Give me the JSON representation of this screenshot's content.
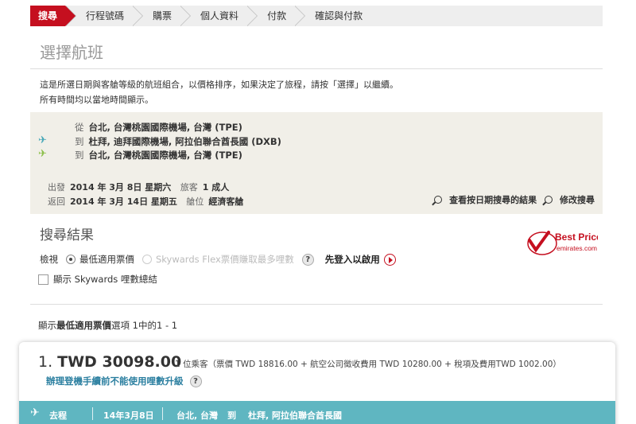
{
  "steps": [
    "搜尋",
    "行程號碼",
    "購票",
    "個人資料",
    "付款",
    "確認與付款"
  ],
  "page_title": "選擇航班",
  "intro": {
    "line1": "這是所選日期與客艙等級的航班組合，以價格排序，如果決定了旅程，請按「選擇」以繼續。",
    "line2": "所有時間均以當地時間顯示。"
  },
  "route": {
    "from_label": "從",
    "from": "台北, 台灣桃園國際機場, 台灣 (TPE)",
    "to_label": "到",
    "to1": "杜拜, 迪拜國際機場, 阿拉伯聯合酋長國 (DXB)",
    "to2": "台北, 台灣桃園國際機場, 台灣 (TPE)"
  },
  "meta": {
    "depart_label": "出發",
    "depart": "2014 年 3月 8日 星期六",
    "pax_label": "旅客",
    "pax": "1 成人",
    "return_label": "返回",
    "return": "2014 年 3月 14日 星期五",
    "cabin_label": "艙位",
    "cabin": "經濟客艙"
  },
  "links": {
    "view_by_date": "查看按日期搜尋的結果",
    "modify": "修改搜尋"
  },
  "results": {
    "title": "搜尋結果",
    "view_label": "檢視",
    "option_lowest": "最低適用票價",
    "option_skywards": "Skywards Flex票價賺取最多哩數",
    "login": "先登入以啟用",
    "show_miles": "顯示 Skywards 哩數總結",
    "count_prefix": "顯示",
    "count_bold": "最低適用票價",
    "count_suffix": "選項 1中的1 - 1"
  },
  "bestprice": {
    "line1": "Best Price",
    "line2": "emirates.com"
  },
  "card": {
    "index": "1.",
    "price": "TWD 30098.00",
    "breakdown": "1 位乘客（票價 TWD 18816.00 + 航空公司徵收費用 TWD 10280.00 + 稅項及費用TWD 1002.00）",
    "warning": "辦理登機手續前不能使用哩數升級",
    "leg_label": "去程",
    "leg_date": "14年3月8日",
    "leg_from": "台北, 台灣",
    "leg_to_word": "到",
    "leg_to": "杜拜, 阿拉伯聯合酋長國"
  },
  "colors": {
    "accent": "#c50f1f",
    "leg_bar": "#5fb6c1",
    "route_bg": "#f1efe8",
    "link_blue": "#2b7fa0"
  },
  "help_icon": "?"
}
